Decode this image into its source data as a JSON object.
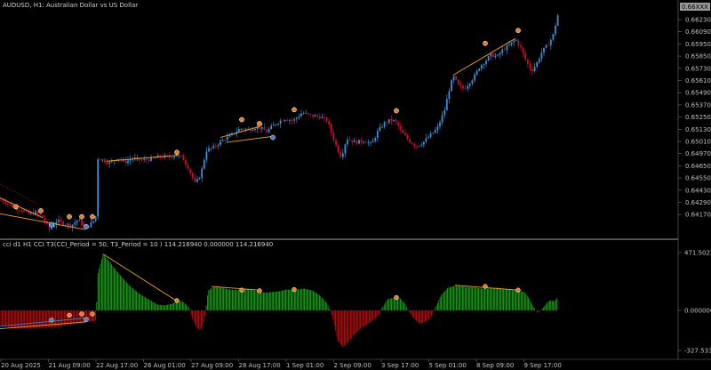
{
  "chart_window": {
    "title": "AUDUSD, H1:  Australian Dollar vs US Dollar",
    "current_price": "0.66XXX",
    "price_ticks": [
      "0.66230",
      "0.66090",
      "0.65950",
      "0.65850",
      "0.65730",
      "0.65610",
      "0.65490",
      "0.65370",
      "0.65250",
      "0.65130",
      "0.65010",
      "0.64970",
      "0.64650",
      "0.64550",
      "0.64430",
      "0.64290",
      "0.64170"
    ],
    "time_ticks": [
      "20 Aug 2025",
      "21 Aug 09:00",
      "22 Aug 17:00",
      "26 Aug 01:00",
      "27 Aug 09:00",
      "28 Aug 17:00",
      "1 Sep 01:00",
      "2 Sep 09:00",
      "3 Sep 17:00",
      "5 Sep 01:00",
      "8 Sep 09:00",
      "9 Sep 17:00"
    ]
  },
  "indicator_window": {
    "label": "cci d1 H1 CCI T3(CCI_Period = 50, T3_Period = 10 ) 114.216940 0.000000 114.216940",
    "ticks": [
      "471.502216",
      "0.000000",
      "-327.53350"
    ]
  },
  "colors": {
    "background": "#000000",
    "bull_candle": "#3a8fd8",
    "bear_candle": "#c8102e",
    "hist_positive": "#1fb41f",
    "hist_negative": "#d01010",
    "divergence_line": "#f0a030",
    "up_marker": "#3a7fd0",
    "down_marker": "#e08020",
    "separator": "#a0a0a0"
  },
  "chart_data": [
    {
      "type": "candlestick",
      "title": "AUDUSD, H1:  Australian Dollar vs US Dollar",
      "ylim": [
        0.6412,
        0.6641
      ],
      "x": [
        "20 Aug 2025",
        "21 Aug 09:00",
        "22 Aug 17:00",
        "26 Aug 01:00",
        "27 Aug 09:00",
        "28 Aug 17:00",
        "1 Sep 01:00",
        "2 Sep 09:00",
        "3 Sep 17:00",
        "5 Sep 01:00",
        "8 Sep 09:00",
        "9 Sep 17:00"
      ],
      "close_path": [
        [
          0,
          0.645
        ],
        [
          8,
          0.6447
        ],
        [
          16,
          0.6442
        ],
        [
          24,
          0.644
        ],
        [
          32,
          0.6436
        ],
        [
          40,
          0.6437
        ],
        [
          48,
          0.6432
        ],
        [
          56,
          0.642
        ],
        [
          64,
          0.6429
        ],
        [
          72,
          0.6426
        ],
        [
          80,
          0.6424
        ],
        [
          88,
          0.643
        ],
        [
          96,
          0.6421
        ],
        [
          104,
          0.6427
        ],
        [
          108,
          0.6434
        ],
        [
          110,
          0.6492
        ],
        [
          116,
          0.649
        ],
        [
          124,
          0.6487
        ],
        [
          132,
          0.6493
        ],
        [
          140,
          0.6488
        ],
        [
          150,
          0.6492
        ],
        [
          160,
          0.649
        ],
        [
          170,
          0.6491
        ],
        [
          180,
          0.6494
        ],
        [
          190,
          0.6493
        ],
        [
          198,
          0.6495
        ],
        [
          205,
          0.6493
        ],
        [
          212,
          0.6482
        ],
        [
          220,
          0.6466
        ],
        [
          226,
          0.6476
        ],
        [
          232,
          0.65
        ],
        [
          240,
          0.6503
        ],
        [
          250,
          0.651
        ],
        [
          260,
          0.6515
        ],
        [
          270,
          0.6522
        ],
        [
          280,
          0.6521
        ],
        [
          290,
          0.6524
        ],
        [
          300,
          0.6519
        ],
        [
          310,
          0.6527
        ],
        [
          320,
          0.6532
        ],
        [
          330,
          0.653
        ],
        [
          340,
          0.6538
        ],
        [
          350,
          0.6535
        ],
        [
          360,
          0.6534
        ],
        [
          368,
          0.653
        ],
        [
          372,
          0.652
        ],
        [
          378,
          0.6505
        ],
        [
          384,
          0.6493
        ],
        [
          390,
          0.6512
        ],
        [
          400,
          0.6508
        ],
        [
          410,
          0.651
        ],
        [
          418,
          0.6506
        ],
        [
          425,
          0.6519
        ],
        [
          432,
          0.6527
        ],
        [
          440,
          0.6531
        ],
        [
          446,
          0.6528
        ],
        [
          452,
          0.6518
        ],
        [
          460,
          0.651
        ],
        [
          468,
          0.6504
        ],
        [
          476,
          0.6508
        ],
        [
          484,
          0.6515
        ],
        [
          492,
          0.6522
        ],
        [
          500,
          0.654
        ],
        [
          505,
          0.656
        ],
        [
          510,
          0.6575
        ],
        [
          516,
          0.6565
        ],
        [
          522,
          0.6562
        ],
        [
          528,
          0.6568
        ],
        [
          534,
          0.6575
        ],
        [
          540,
          0.6585
        ],
        [
          546,
          0.659
        ],
        [
          552,
          0.6596
        ],
        [
          560,
          0.6595
        ],
        [
          566,
          0.6602
        ],
        [
          572,
          0.6605
        ],
        [
          580,
          0.6612
        ],
        [
          586,
          0.6603
        ],
        [
          592,
          0.659
        ],
        [
          598,
          0.658
        ],
        [
          604,
          0.6588
        ],
        [
          610,
          0.66
        ],
        [
          616,
          0.6606
        ],
        [
          622,
          0.6615
        ],
        [
          628,
          0.6638
        ]
      ]
    },
    {
      "type": "bar",
      "title": "cci d1 H1 CCI T3(CCI_Period = 50, T3_Period = 10 ) 114.216940 0.000000 114.216940",
      "ylim": [
        -327.5335,
        471.502216
      ],
      "series": [
        {
          "values_path": [
            [
              0,
              -120
            ],
            [
              20,
              -150
            ],
            [
              40,
              -145
            ],
            [
              60,
              -140
            ],
            [
              80,
              -115
            ],
            [
              100,
              -95
            ],
            [
              108,
              -85
            ],
            [
              110,
              300
            ],
            [
              116,
              460
            ],
            [
              122,
              410
            ],
            [
              128,
              350
            ],
            [
              136,
              280
            ],
            [
              146,
              200
            ],
            [
              156,
              140
            ],
            [
              166,
              95
            ],
            [
              178,
              45
            ],
            [
              186,
              40
            ],
            [
              194,
              55
            ],
            [
              200,
              80
            ],
            [
              206,
              70
            ],
            [
              212,
              30
            ],
            [
              216,
              -60
            ],
            [
              222,
              -150
            ],
            [
              226,
              -160
            ],
            [
              230,
              -80
            ],
            [
              234,
              160
            ],
            [
              240,
              190
            ],
            [
              248,
              185
            ],
            [
              258,
              170
            ],
            [
              268,
              165
            ],
            [
              278,
              175
            ],
            [
              288,
              160
            ],
            [
              298,
              145
            ],
            [
              306,
              150
            ],
            [
              314,
              155
            ],
            [
              322,
              170
            ],
            [
              332,
              165
            ],
            [
              342,
              178
            ],
            [
              352,
              160
            ],
            [
              360,
              120
            ],
            [
              368,
              60
            ],
            [
              374,
              -50
            ],
            [
              380,
              -250
            ],
            [
              386,
              -300
            ],
            [
              392,
              -260
            ],
            [
              398,
              -200
            ],
            [
              406,
              -150
            ],
            [
              414,
              -110
            ],
            [
              420,
              -80
            ],
            [
              426,
              -40
            ],
            [
              430,
              20
            ],
            [
              436,
              90
            ],
            [
              444,
              105
            ],
            [
              450,
              100
            ],
            [
              456,
              50
            ],
            [
              460,
              -10
            ],
            [
              466,
              -70
            ],
            [
              472,
              -110
            ],
            [
              480,
              -90
            ],
            [
              486,
              -45
            ],
            [
              490,
              20
            ],
            [
              496,
              120
            ],
            [
              504,
              185
            ],
            [
              512,
              200
            ],
            [
              520,
              195
            ],
            [
              528,
              190
            ],
            [
              536,
              185
            ],
            [
              544,
              175
            ],
            [
              552,
              180
            ],
            [
              560,
              185
            ],
            [
              568,
              175
            ],
            [
              576,
              165
            ],
            [
              584,
              160
            ],
            [
              590,
              150
            ],
            [
              596,
              90
            ],
            [
              600,
              30
            ],
            [
              604,
              -10
            ],
            [
              606,
              -20
            ],
            [
              612,
              30
            ],
            [
              618,
              80
            ],
            [
              624,
              75
            ],
            [
              628,
              110
            ]
          ]
        }
      ]
    }
  ]
}
